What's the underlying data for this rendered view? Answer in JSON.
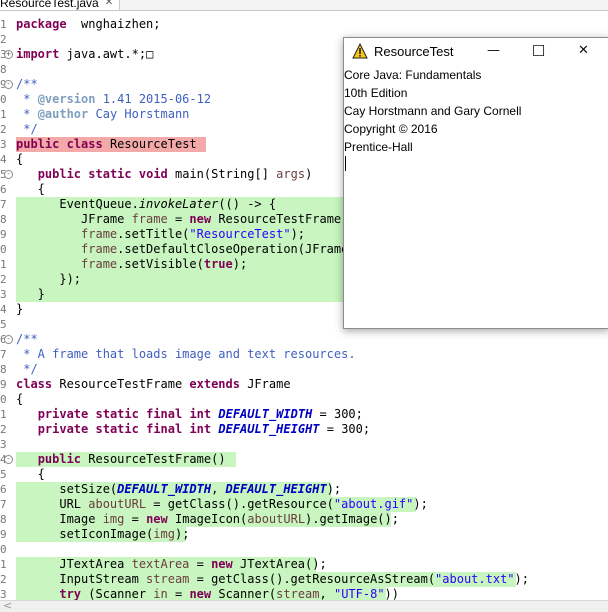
{
  "editor": {
    "tab_label": "ResourceTest.java",
    "tab_close_glyph": "✕",
    "lines": [
      {
        "ln": "1",
        "fold": "",
        "segs": [
          [
            "kw",
            "package"
          ],
          [
            "",
            "  wnghaizhen;"
          ]
        ]
      },
      {
        "ln": "2",
        "fold": "",
        "segs": []
      },
      {
        "ln": "3",
        "fold": "+",
        "segs": [
          [
            "kw",
            "import"
          ],
          [
            "",
            " java.awt.*;"
          ],
          [
            "",
            "□"
          ]
        ]
      },
      {
        "ln": "8",
        "fold": "",
        "segs": []
      },
      {
        "ln": "9",
        "fold": "-",
        "segs": [
          [
            "cm",
            "/**"
          ]
        ]
      },
      {
        "ln": "0",
        "fold": "",
        "segs": [
          [
            "cm",
            " * "
          ],
          [
            "tag",
            "@version"
          ],
          [
            "cm",
            " 1.41 2015-06-12"
          ]
        ]
      },
      {
        "ln": "1",
        "fold": "",
        "segs": [
          [
            "cm",
            " * "
          ],
          [
            "tag",
            "@author"
          ],
          [
            "cm",
            " Cay Horstmann"
          ]
        ]
      },
      {
        "ln": "2",
        "fold": "",
        "segs": [
          [
            "cm",
            " */"
          ]
        ]
      },
      {
        "ln": "3",
        "fold": "",
        "hl": "red",
        "hlw": 190,
        "segs": [
          [
            "kw",
            "public"
          ],
          [
            "",
            " "
          ],
          [
            "kw",
            "class"
          ],
          [
            "",
            " ResourceTest"
          ]
        ]
      },
      {
        "ln": "4",
        "fold": "",
        "segs": [
          [
            "",
            "{"
          ]
        ]
      },
      {
        "ln": "5",
        "fold": "-",
        "segs": [
          [
            "",
            "   "
          ],
          [
            "kw",
            "public"
          ],
          [
            "",
            " "
          ],
          [
            "kw",
            "static"
          ],
          [
            "",
            " "
          ],
          [
            "kw",
            "void"
          ],
          [
            "",
            " main(String[] "
          ],
          [
            "vr",
            "args"
          ],
          [
            "",
            ")"
          ]
        ]
      },
      {
        "ln": "6",
        "fold": "",
        "segs": [
          [
            "",
            "   {"
          ]
        ]
      },
      {
        "ln": "7",
        "fold": "",
        "hl": "green",
        "hlw": 330,
        "segs": [
          [
            "",
            "      EventQueue."
          ],
          [
            "it",
            "invokeLater"
          ],
          [
            "",
            "(() -> {"
          ]
        ]
      },
      {
        "ln": "8",
        "fold": "",
        "hl": "green",
        "hlw": 330,
        "segs": [
          [
            "",
            "         JFrame "
          ],
          [
            "vr",
            "frame"
          ],
          [
            "",
            " = "
          ],
          [
            "kw",
            "new"
          ],
          [
            "",
            " ResourceTestFrame()"
          ]
        ]
      },
      {
        "ln": "9",
        "fold": "",
        "hl": "green",
        "hlw": 330,
        "segs": [
          [
            "",
            "         "
          ],
          [
            "vr",
            "frame"
          ],
          [
            "",
            ".setTitle("
          ],
          [
            "st",
            "\"ResourceTest\""
          ],
          [
            "",
            ");"
          ]
        ]
      },
      {
        "ln": "0",
        "fold": "",
        "hl": "green",
        "hlw": 330,
        "segs": [
          [
            "",
            "         "
          ],
          [
            "vr",
            "frame"
          ],
          [
            "",
            ".setDefaultCloseOperation(JFrame."
          ]
        ]
      },
      {
        "ln": "1",
        "fold": "",
        "hl": "green",
        "hlw": 330,
        "segs": [
          [
            "",
            "         "
          ],
          [
            "vr",
            "frame"
          ],
          [
            "",
            ".setVisible("
          ],
          [
            "kw",
            "true"
          ],
          [
            "",
            ");"
          ]
        ]
      },
      {
        "ln": "2",
        "fold": "",
        "hl": "green",
        "hlw": 330,
        "segs": [
          [
            "",
            "      });"
          ]
        ]
      },
      {
        "ln": "3",
        "fold": "",
        "hl": "green",
        "hlw": 330,
        "segs": [
          [
            "",
            "   }"
          ]
        ]
      },
      {
        "ln": "4",
        "fold": "",
        "segs": [
          [
            "",
            "}"
          ]
        ]
      },
      {
        "ln": "5",
        "fold": "",
        "segs": []
      },
      {
        "ln": "6",
        "fold": "-",
        "segs": [
          [
            "cm",
            "/**"
          ]
        ]
      },
      {
        "ln": "7",
        "fold": "",
        "segs": [
          [
            "cm",
            " * A frame that loads image and text resources."
          ]
        ]
      },
      {
        "ln": "8",
        "fold": "",
        "segs": [
          [
            "cm",
            " */"
          ]
        ]
      },
      {
        "ln": "9",
        "fold": "",
        "segs": [
          [
            "kw",
            "class"
          ],
          [
            "",
            " ResourceTestFrame "
          ],
          [
            "kw",
            "extends"
          ],
          [
            "",
            " JFrame"
          ]
        ]
      },
      {
        "ln": "0",
        "fold": "",
        "segs": [
          [
            "",
            "{"
          ]
        ]
      },
      {
        "ln": "1",
        "fold": "",
        "segs": [
          [
            "",
            "   "
          ],
          [
            "kw",
            "private"
          ],
          [
            "",
            " "
          ],
          [
            "kw",
            "static"
          ],
          [
            "",
            " "
          ],
          [
            "kw",
            "final"
          ],
          [
            "",
            " "
          ],
          [
            "kw",
            "int"
          ],
          [
            "",
            " "
          ],
          [
            "fd",
            "DEFAULT_WIDTH"
          ],
          [
            "",
            " = 300;"
          ]
        ]
      },
      {
        "ln": "2",
        "fold": "",
        "segs": [
          [
            "",
            "   "
          ],
          [
            "kw",
            "private"
          ],
          [
            "",
            " "
          ],
          [
            "kw",
            "static"
          ],
          [
            "",
            " "
          ],
          [
            "kw",
            "final"
          ],
          [
            "",
            " "
          ],
          [
            "kw",
            "int"
          ],
          [
            "",
            " "
          ],
          [
            "fd",
            "DEFAULT_HEIGHT"
          ],
          [
            "",
            " = 300;"
          ]
        ]
      },
      {
        "ln": "3",
        "fold": "",
        "segs": []
      },
      {
        "ln": "4",
        "fold": "-",
        "hl": "green",
        "hlw": 220,
        "segs": [
          [
            "",
            "   "
          ],
          [
            "kw",
            "public"
          ],
          [
            "",
            " ResourceTestFrame()"
          ]
        ]
      },
      {
        "ln": "5",
        "fold": "",
        "segs": [
          [
            "",
            "   {"
          ]
        ]
      },
      {
        "ln": "6",
        "fold": "",
        "hl": "green",
        "hlw": 315,
        "segs": [
          [
            "",
            "      setSize("
          ],
          [
            "fd",
            "DEFAULT_WIDTH"
          ],
          [
            "",
            ", "
          ],
          [
            "fd",
            "DEFAULT_HEIGHT"
          ],
          [
            "",
            ");"
          ]
        ]
      },
      {
        "ln": "7",
        "fold": "",
        "hl": "green",
        "hlw": 400,
        "segs": [
          [
            "",
            "      URL "
          ],
          [
            "vr",
            "aboutURL"
          ],
          [
            "",
            " = getClass().getResource("
          ],
          [
            "st",
            "\"about.gif\""
          ],
          [
            "",
            ");"
          ]
        ]
      },
      {
        "ln": "8",
        "fold": "",
        "hl": "green",
        "hlw": 375,
        "segs": [
          [
            "",
            "      Image "
          ],
          [
            "vr",
            "img"
          ],
          [
            "",
            " = "
          ],
          [
            "kw",
            "new"
          ],
          [
            "",
            " ImageIcon("
          ],
          [
            "vr",
            "aboutURL"
          ],
          [
            "",
            ").getImage();"
          ]
        ]
      },
      {
        "ln": "9",
        "fold": "",
        "hl": "green",
        "hlw": 170,
        "segs": [
          [
            "",
            "      setIconImage("
          ],
          [
            "vr",
            "img"
          ],
          [
            "",
            ");"
          ]
        ]
      },
      {
        "ln": "0",
        "fold": "",
        "segs": []
      },
      {
        "ln": "1",
        "fold": "",
        "hl": "green",
        "hlw": 300,
        "segs": [
          [
            "",
            "      JTextArea "
          ],
          [
            "vr",
            "textArea"
          ],
          [
            "",
            " = "
          ],
          [
            "kw",
            "new"
          ],
          [
            "",
            " JTextArea();"
          ]
        ]
      },
      {
        "ln": "2",
        "fold": "",
        "hl": "green",
        "hlw": 500,
        "segs": [
          [
            "",
            "      InputStream "
          ],
          [
            "vr",
            "stream"
          ],
          [
            "",
            " = getClass().getResourceAsStream("
          ],
          [
            "st",
            "\"about.txt\""
          ],
          [
            "",
            ");"
          ]
        ]
      },
      {
        "ln": "3",
        "fold": "",
        "hl": "green",
        "hlw": 370,
        "segs": [
          [
            "",
            "      "
          ],
          [
            "kw",
            "try"
          ],
          [
            "",
            " (Scanner "
          ],
          [
            "vr",
            "in"
          ],
          [
            "",
            " = "
          ],
          [
            "kw",
            "new"
          ],
          [
            "",
            " Scanner("
          ],
          [
            "vr",
            "stream"
          ],
          [
            "",
            ", "
          ],
          [
            "st",
            "\"UTF-8\""
          ],
          [
            "",
            "))"
          ]
        ]
      }
    ]
  },
  "window": {
    "title": "ResourceTest",
    "minimize_glyph": "—",
    "maximize_glyph": "☐",
    "close_glyph": "✕",
    "text_lines": [
      "Core Java: Fundamentals",
      "10th Edition",
      "Cay Horstmann and Gary Cornell",
      "Copyright © 2016",
      "Prentice-Hall"
    ]
  },
  "scrollbar": {
    "left_arrow_glyph": "<"
  },
  "colors": {
    "keyword": "#7f0055",
    "comment": "#3f5fbf",
    "string": "#2a00ff",
    "field": "#0000c0",
    "highlight_green": "#c8f5c0",
    "highlight_red": "#f4a9a9"
  }
}
